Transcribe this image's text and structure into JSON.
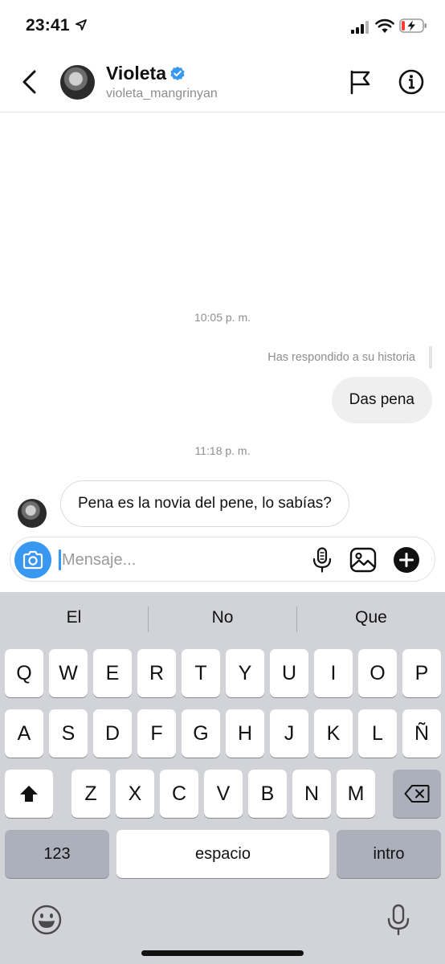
{
  "status_bar": {
    "time": "23:41",
    "icons": [
      "location-arrow-icon",
      "cellular-signal-icon",
      "wifi-icon",
      "battery-charging-icon"
    ],
    "battery_color": "#ff3b30"
  },
  "header": {
    "name": "Violeta",
    "username": "violeta_mangrinyan",
    "verified": true,
    "verified_color": "#3897f0",
    "icons": [
      "back-chevron-icon",
      "flag-icon",
      "info-icon"
    ]
  },
  "chat": {
    "timestamp_1": "10:05 p. m.",
    "reply_note": "Has respondido a su historia",
    "outgoing_message": "Das pena",
    "timestamp_2": "11:18 p. m.",
    "incoming_message": "Pena es la novia del pene, lo sabías?"
  },
  "composer": {
    "placeholder": "Mensaje...",
    "value": "",
    "accent": "#3897f0",
    "icons": [
      "camera-icon",
      "microphone-icon",
      "gallery-icon",
      "plus-icon"
    ]
  },
  "keyboard": {
    "suggestions": [
      "El",
      "No",
      "Que"
    ],
    "row1": [
      "Q",
      "W",
      "E",
      "R",
      "T",
      "Y",
      "U",
      "I",
      "O",
      "P"
    ],
    "row2": [
      "A",
      "S",
      "D",
      "F",
      "G",
      "H",
      "J",
      "K",
      "L",
      "Ñ"
    ],
    "row3": [
      "Z",
      "X",
      "C",
      "V",
      "B",
      "N",
      "M"
    ],
    "numbers_key": "123",
    "space_key": "espacio",
    "return_key": "intro",
    "icons": [
      "shift-icon",
      "backspace-icon",
      "emoji-icon",
      "dictation-mic-icon"
    ]
  }
}
